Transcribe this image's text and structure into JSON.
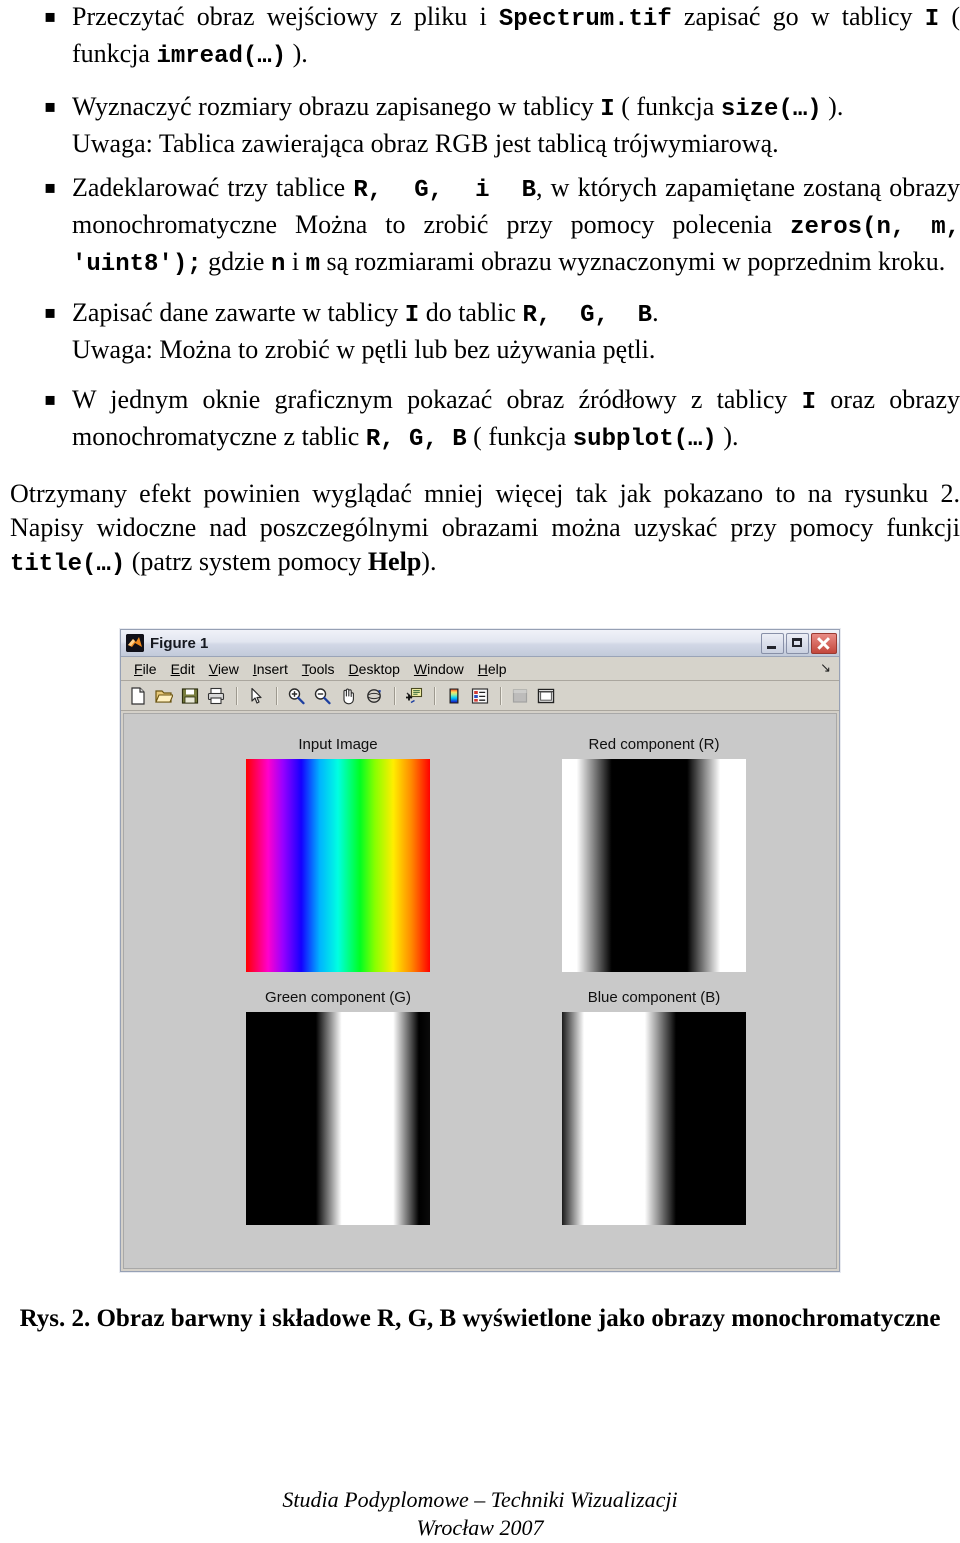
{
  "document": {
    "bullet_glyph": "▪",
    "items": [
      {
        "id": "task-imread",
        "segments": [
          {
            "t": "Przeczytać obraz wejściowy z pliku i ",
            "s": "plain"
          },
          {
            "t": "Spectrum.tif",
            "s": "mono"
          },
          {
            "t": " zapisać go w tablicy ",
            "s": "plain"
          },
          {
            "t": "I",
            "s": "mono"
          },
          {
            "t": " ( funkcja ",
            "s": "plain"
          },
          {
            "t": "imread(…)",
            "s": "mono"
          },
          {
            "t": " ).",
            "s": "plain"
          }
        ]
      },
      {
        "id": "task-size",
        "segments": [
          {
            "t": "Wyznaczyć rozmiary obrazu zapisanego w tablicy ",
            "s": "plain"
          },
          {
            "t": "I",
            "s": "mono"
          },
          {
            "t": " ( funkcja ",
            "s": "plain"
          },
          {
            "t": "size(…)",
            "s": "mono"
          },
          {
            "t": " ).",
            "s": "plain"
          }
        ],
        "note": "Uwaga: Tablica zawierająca obraz RGB jest tablicą trójwymiarową."
      },
      {
        "id": "task-zeros",
        "segments": [
          {
            "t": "Zadeklarować trzy tablice ",
            "s": "plain"
          },
          {
            "t": "R,  G,  i  B",
            "s": "mono"
          },
          {
            "t": ", w których zapamiętane zostaną obrazy monochromatyczne Można to zrobić przy pomocy polecenia ",
            "s": "plain"
          },
          {
            "t": "zeros(n, m, 'uint8');",
            "s": "mono"
          },
          {
            "t": " gdzie ",
            "s": "plain"
          },
          {
            "t": "n",
            "s": "mono"
          },
          {
            "t": " i ",
            "s": "plain"
          },
          {
            "t": "m",
            "s": "mono"
          },
          {
            "t": " są rozmiarami obrazu wyznaczonymi w poprzednim kroku.",
            "s": "plain"
          }
        ]
      },
      {
        "id": "task-assign",
        "segments": [
          {
            "t": "Zapisać dane zawarte w tablicy ",
            "s": "plain"
          },
          {
            "t": "I",
            "s": "mono"
          },
          {
            "t": " do tablic ",
            "s": "plain"
          },
          {
            "t": "R,  G,  B",
            "s": "mono"
          },
          {
            "t": ".",
            "s": "plain"
          }
        ],
        "note": "Uwaga: Można to zrobić w pętli lub bez używania pętli."
      },
      {
        "id": "task-subplot",
        "segments": [
          {
            "t": "W jednym oknie graficznym pokazać obraz źródłowy z tablicy ",
            "s": "plain"
          },
          {
            "t": "I",
            "s": "mono"
          },
          {
            "t": " oraz obrazy monochromatyczne z tablic ",
            "s": "plain"
          },
          {
            "t": "R, G, B",
            "s": "mono"
          },
          {
            "t": " ( funkcja ",
            "s": "plain"
          },
          {
            "t": "subplot(…)",
            "s": "mono"
          },
          {
            "t": " ).",
            "s": "plain"
          }
        ]
      }
    ],
    "closing_paragraph": [
      {
        "t": "Otrzymany efekt powinien wyglądać mniej więcej tak jak pokazano to na rysunku 2. Napisy widoczne nad poszczególnymi obrazami można uzyskać przy pomocy funkcji ",
        "s": "plain"
      },
      {
        "t": "title(…)",
        "s": "mono"
      },
      {
        "t": " (patrz system pomocy ",
        "s": "plain"
      },
      {
        "t": "Help",
        "s": "bold"
      },
      {
        "t": ").",
        "s": "plain"
      }
    ],
    "figure_caption": "Rys. 2. Obraz barwny i składowe R, G, B wyświetlone jako obrazy monochromatyczne",
    "footer": {
      "line1": "Studia Podyplomowe – Techniki Wizualizacji",
      "line2": "Wrocław 2007"
    }
  },
  "figure_window": {
    "title": "Figure 1",
    "app_icon": "matlab-icon",
    "window_controls": {
      "minimize": "minimize-icon",
      "maximize": "maximize-icon",
      "close": "close-icon"
    },
    "menu": [
      {
        "label": "File",
        "accel": "F"
      },
      {
        "label": "Edit",
        "accel": "E"
      },
      {
        "label": "View",
        "accel": "V"
      },
      {
        "label": "Insert",
        "accel": "I"
      },
      {
        "label": "Tools",
        "accel": "T"
      },
      {
        "label": "Desktop",
        "accel": "D"
      },
      {
        "label": "Window",
        "accel": "W"
      },
      {
        "label": "Help",
        "accel": "H"
      }
    ],
    "menu_overflow_glyph": "↘",
    "toolbar": [
      {
        "name": "new-figure-icon",
        "tooltip": "New Figure"
      },
      {
        "name": "open-file-icon",
        "tooltip": "Open File"
      },
      {
        "name": "save-figure-icon",
        "tooltip": "Save Figure"
      },
      {
        "name": "print-figure-icon",
        "tooltip": "Print Figure"
      },
      {
        "name": "separator"
      },
      {
        "name": "edit-plot-icon",
        "tooltip": "Edit Plot"
      },
      {
        "name": "separator"
      },
      {
        "name": "zoom-in-icon",
        "tooltip": "Zoom In"
      },
      {
        "name": "zoom-out-icon",
        "tooltip": "Zoom Out"
      },
      {
        "name": "pan-icon",
        "tooltip": "Pan"
      },
      {
        "name": "rotate-3d-icon",
        "tooltip": "Rotate 3D"
      },
      {
        "name": "separator"
      },
      {
        "name": "data-cursor-icon",
        "tooltip": "Data Cursor"
      },
      {
        "name": "separator"
      },
      {
        "name": "colorbar-icon",
        "tooltip": "Insert Colorbar"
      },
      {
        "name": "legend-icon",
        "tooltip": "Insert Legend"
      },
      {
        "name": "separator"
      },
      {
        "name": "hide-plot-tools-icon",
        "tooltip": "Hide Plot Tools",
        "disabled": true
      },
      {
        "name": "show-plot-tools-icon",
        "tooltip": "Show Plot Tools"
      }
    ],
    "canvas_color": "#c9c9c9",
    "subplots": [
      {
        "id": "subplot-input",
        "title": "Input Image",
        "image": "spectrum-rgb",
        "gradient": "linear-gradient(to right, #ff0000 0%, #ff00cc 12%, #9900ff 20%, #1500ff 30%, #00b3ff 40%, #00ffe1 50%, #00ff22 62%, #88ff00 70%, #ffee00 80%, #ff8800 90%, #ff0000 100%)"
      },
      {
        "id": "subplot-red",
        "title": "Red component (R)",
        "image": "red-channel-gray",
        "gradient": "linear-gradient(to right, #ffffff 0%, #ffffff 8%, #000000 27%, #000000 68%, #ffffff 86%, #ffffff 100%)"
      },
      {
        "id": "subplot-green",
        "title": "Green component (G)",
        "image": "green-channel-gray",
        "gradient": "linear-gradient(to right, #000000 0%, #000000 38%, #ffffff 52%, #ffffff 80%, #000000 94%, #0a0a0a 100%)"
      },
      {
        "id": "subplot-blue",
        "title": "Blue component (B)",
        "image": "blue-channel-gray",
        "gradient": "linear-gradient(to right, #1a1a1a 0%, #ffffff 12%, #ffffff 45%, #000000 62%, #000000 100%)"
      }
    ]
  },
  "colors": {
    "page_background": "#ffffff",
    "text": "#000000",
    "window_chrome": "#d6d3cb",
    "titlebar_gradient_start": "#f0f2f8",
    "titlebar_gradient_end": "#c2cada",
    "close_button": "#c3473c",
    "figure_canvas": "#c9c9c9"
  }
}
